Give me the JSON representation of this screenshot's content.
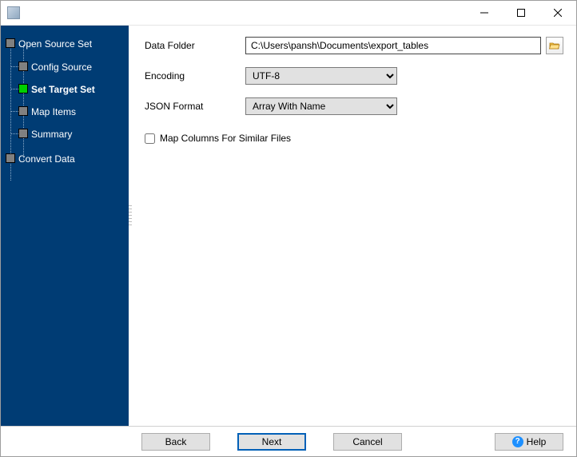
{
  "titlebar": {
    "title": ""
  },
  "sidebar": {
    "items": [
      {
        "label": "Open Source Set",
        "level": 0,
        "active": false
      },
      {
        "label": "Config Source",
        "level": 1,
        "active": false
      },
      {
        "label": "Set Target Set",
        "level": 1,
        "active": true
      },
      {
        "label": "Map Items",
        "level": 1,
        "active": false
      },
      {
        "label": "Summary",
        "level": 1,
        "active": false
      },
      {
        "label": "Convert Data",
        "level": 0,
        "active": false
      }
    ]
  },
  "form": {
    "data_folder_label": "Data Folder",
    "data_folder_value": "C:\\Users\\pansh\\Documents\\export_tables",
    "encoding_label": "Encoding",
    "encoding_value": "UTF-8",
    "json_format_label": "JSON Format",
    "json_format_value": "Array With Name",
    "map_columns_label": "Map Columns For Similar Files",
    "map_columns_checked": false
  },
  "footer": {
    "back_label": "Back",
    "next_label": "Next",
    "cancel_label": "Cancel",
    "help_label": "Help"
  }
}
